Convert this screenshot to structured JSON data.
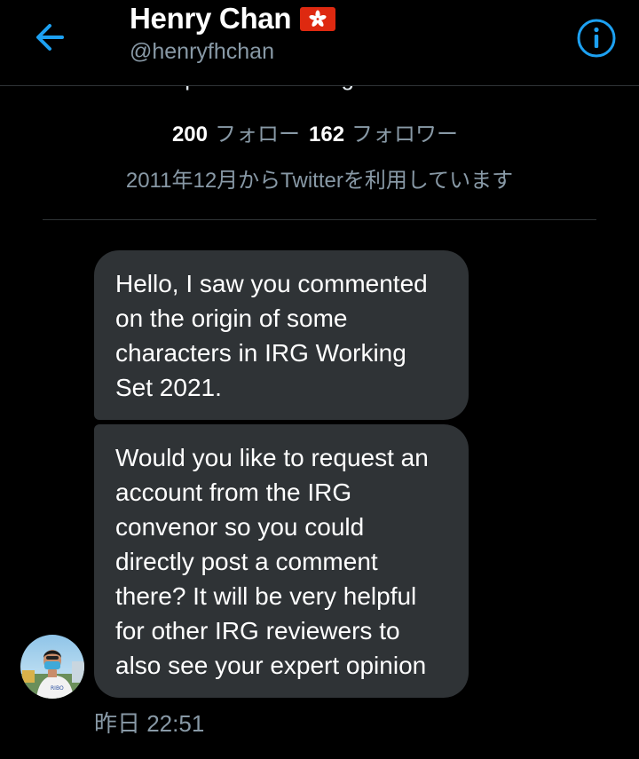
{
  "header": {
    "name": "Henry Chan",
    "handle": "@henryfhchan",
    "flag_icon": "hong-kong-flag-icon",
    "back_icon": "arrow-left-icon",
    "info_icon": "info-circle-icon"
  },
  "profile": {
    "bio_cut": "Group · Software engineer at Canon",
    "following_count": "200",
    "following_label": "フォロー",
    "followers_count": "162",
    "followers_label": "フォロワー",
    "joined": "2011年12月からTwitterを利用しています"
  },
  "messages": [
    {
      "text": "Hello, I saw you commented\non the origin of some\ncharacters in IRG Working\nSet 2021."
    },
    {
      "text": "Would you like to request an\naccount from the IRG\nconvenor so you could\ndirectly post a comment\nthere? It will be very helpful\nfor other IRG reviewers to\nalso see your expert opinion"
    }
  ],
  "timestamp": "昨日 22:51",
  "colors": {
    "background": "#000000",
    "accent": "#1da1f2",
    "bubble": "#2f3336",
    "secondary_text": "#8899a6"
  }
}
